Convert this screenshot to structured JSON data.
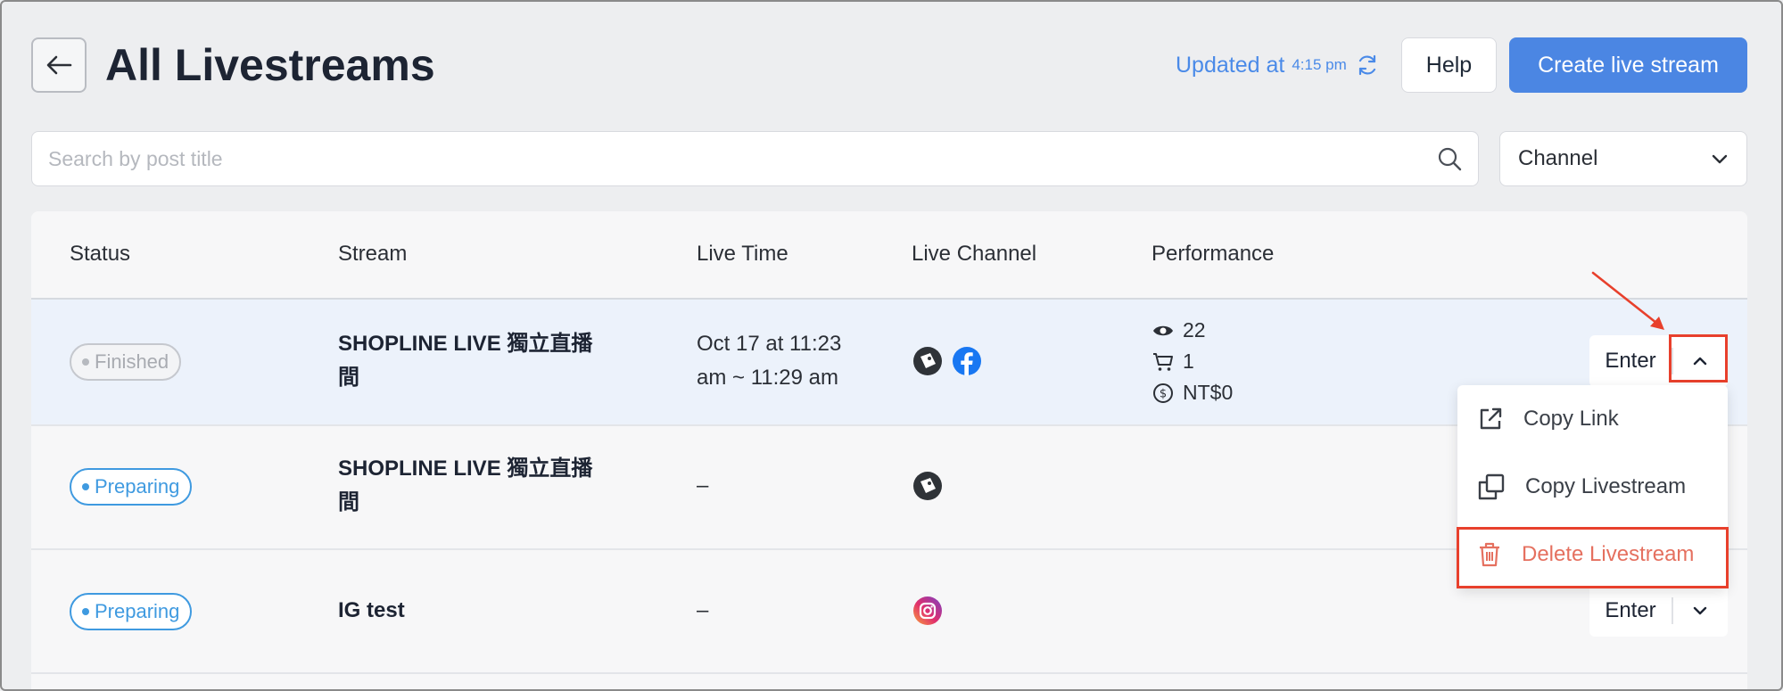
{
  "header": {
    "title": "All Livestreams",
    "updated_label": "Updated at",
    "updated_time": "4:15 pm",
    "help_label": "Help",
    "create_label": "Create live stream"
  },
  "search": {
    "placeholder": "Search by post title"
  },
  "filter": {
    "channel_label": "Channel"
  },
  "table": {
    "columns": [
      "Status",
      "Stream",
      "Live Time",
      "Live Channel",
      "Performance"
    ],
    "rows": [
      {
        "status": "Finished",
        "stream_line1": "SHOPLINE LIVE 獨立直播",
        "stream_line2": "間",
        "live_time_line1": "Oct 17 at 11:23",
        "live_time_line2": "am ~ 11:29 am",
        "channels": [
          "shopline-icon",
          "facebook-icon"
        ],
        "views": "22",
        "orders": "1",
        "revenue": "NT$0",
        "enter_label": "Enter"
      },
      {
        "status": "Preparing",
        "stream_line1": "SHOPLINE LIVE 獨立直播",
        "stream_line2": "間",
        "live_time": "–",
        "channels": [
          "shopline-icon"
        ]
      },
      {
        "status": "Preparing",
        "stream_line1": "IG test",
        "live_time": "–",
        "channels": [
          "instagram-icon"
        ],
        "enter_label": "Enter"
      }
    ]
  },
  "dropdown": {
    "items": [
      {
        "label": "Copy Link",
        "icon": "external-link-icon"
      },
      {
        "label": "Copy Livestream",
        "icon": "copy-icon"
      },
      {
        "label": "Delete Livestream",
        "icon": "trash-icon"
      }
    ]
  },
  "colors": {
    "accent": "#4b86e3",
    "link": "#4a8ae8",
    "preparing": "#3f9ae0",
    "danger": "#e5705f",
    "annotation": "#e8402c"
  }
}
